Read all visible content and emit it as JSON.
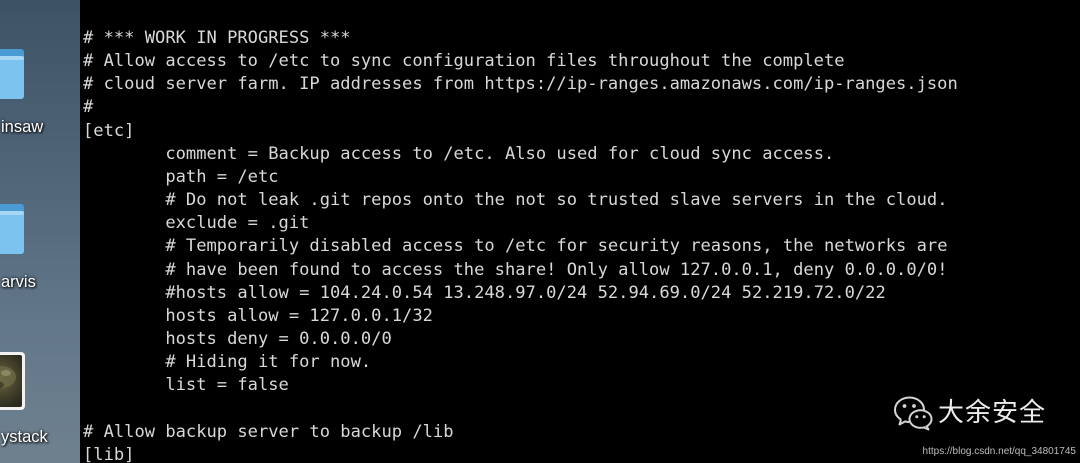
{
  "desktop": {
    "wallpaper_color": "#566b7d",
    "icons": [
      {
        "label": "insaw",
        "icon": "folder-icon"
      },
      {
        "label": "arvis",
        "icon": "folder-icon"
      },
      {
        "label": "ystack",
        "icon": "image-file-icon"
      }
    ]
  },
  "terminal": {
    "background": "#000000",
    "foreground": "#d8d8d8",
    "lines": [
      "# *** WORK IN PROGRESS ***",
      "# Allow access to /etc to sync configuration files throughout the complete",
      "# cloud server farm. IP addresses from https://ip-ranges.amazonaws.com/ip-ranges.json",
      "#",
      "[etc]",
      "\tcomment = Backup access to /etc. Also used for cloud sync access.",
      "\tpath = /etc",
      "\t# Do not leak .git repos onto the not so trusted slave servers in the cloud.",
      "\texclude = .git",
      "\t# Temporarily disabled access to /etc for security reasons, the networks are",
      "\t# have been found to access the share! Only allow 127.0.0.1, deny 0.0.0.0/0!",
      "\t#hosts allow = 104.24.0.54 13.248.97.0/24 52.94.69.0/24 52.219.72.0/22",
      "\thosts allow = 127.0.0.1/32",
      "\thosts deny = 0.0.0.0/0",
      "\t# Hiding it for now.",
      "\tlist = false",
      "",
      "# Allow backup server to backup /lib",
      "[lib]"
    ]
  },
  "watermark": {
    "icon": "wechat-icon",
    "brand": "大余安全",
    "url": "https://blog.csdn.net/qq_34801745"
  }
}
